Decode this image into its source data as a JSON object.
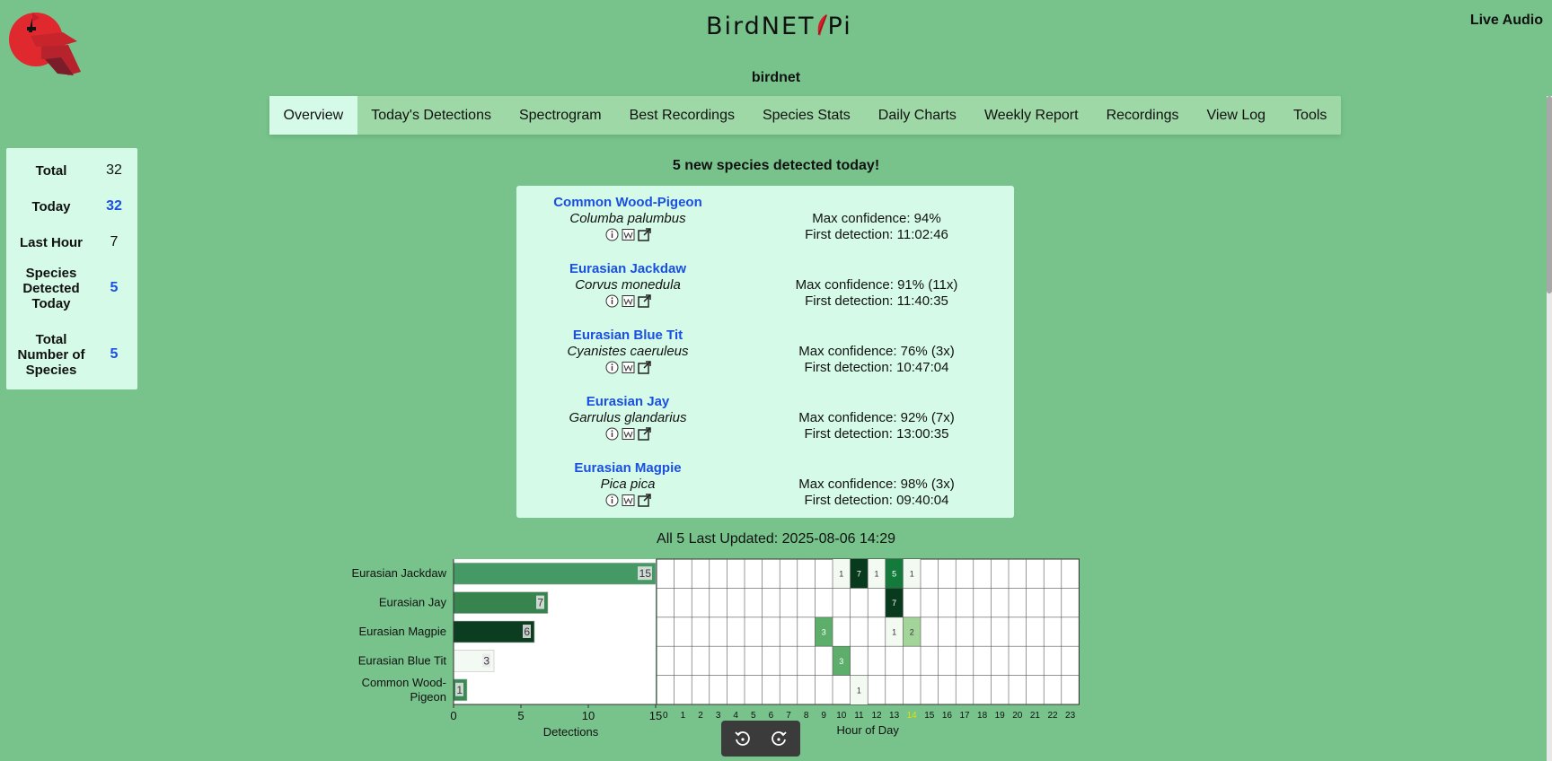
{
  "header": {
    "brand_left": "BirdNET",
    "brand_right": "Pi",
    "live_audio": "Live Audio",
    "site_name": "birdnet"
  },
  "nav": {
    "tabs": [
      {
        "label": "Overview",
        "active": true
      },
      {
        "label": "Today's Detections"
      },
      {
        "label": "Spectrogram"
      },
      {
        "label": "Best Recordings"
      },
      {
        "label": "Species Stats"
      },
      {
        "label": "Daily Charts"
      },
      {
        "label": "Weekly Report"
      },
      {
        "label": "Recordings"
      },
      {
        "label": "View Log"
      },
      {
        "label": "Tools"
      }
    ]
  },
  "stats": [
    {
      "label": "Total",
      "value": "32"
    },
    {
      "label": "Today",
      "value": "32"
    },
    {
      "label": "Last Hour",
      "value": "7"
    },
    {
      "label": "Species Detected Today",
      "value": "5"
    },
    {
      "label": "Total Number of Species",
      "value": "5"
    }
  ],
  "new_species_heading": "5 new species detected today!",
  "species": [
    {
      "common": "Common Wood-Pigeon",
      "scientific": "Columba palumbus",
      "confidence": "Max confidence: 94%",
      "first": "First detection: 11:02:46"
    },
    {
      "common": "Eurasian Jackdaw",
      "scientific": "Corvus monedula",
      "confidence": "Max confidence: 91% (11x)",
      "first": "First detection: 11:40:35"
    },
    {
      "common": "Eurasian Blue Tit",
      "scientific": "Cyanistes caeruleus",
      "confidence": "Max confidence: 76% (3x)",
      "first": "First detection: 10:47:04"
    },
    {
      "common": "Eurasian Jay",
      "scientific": "Garrulus glandarius",
      "confidence": "Max confidence: 92% (7x)",
      "first": "First detection: 13:00:35"
    },
    {
      "common": "Eurasian Magpie",
      "scientific": "Pica pica",
      "confidence": "Max confidence: 98% (3x)",
      "first": "First detection: 09:40:04"
    }
  ],
  "updated_text": "All 5 Last Updated: 2025-08-06 14:29",
  "colors": {
    "background": "#77c38b",
    "card": "#d5fbe8",
    "nav": "#9ed8a6",
    "link": "#1a4fe0",
    "current_hour": "#e0e000"
  },
  "chart_data": [
    {
      "type": "bar",
      "orientation": "horizontal",
      "categories": [
        "Eurasian Jackdaw",
        "Eurasian Jay",
        "Eurasian Magpie",
        "Eurasian Blue Tit",
        "Common Wood-Pigeon"
      ],
      "values": [
        15,
        7,
        6,
        3,
        1
      ],
      "xlabel": "Detections",
      "xlim": [
        0,
        15
      ],
      "xticks": [
        0,
        5,
        10,
        15
      ],
      "bar_colors": [
        "#449964",
        "#37844f",
        "#0c3d21",
        "#f3faf3",
        "#3a8a56"
      ]
    },
    {
      "type": "heatmap",
      "rows": [
        "Eurasian Jackdaw",
        "Eurasian Jay",
        "Eurasian Magpie",
        "Eurasian Blue Tit",
        "Common Wood-Pigeon"
      ],
      "x": [
        0,
        1,
        2,
        3,
        4,
        5,
        6,
        7,
        8,
        9,
        10,
        11,
        12,
        13,
        14,
        15,
        16,
        17,
        18,
        19,
        20,
        21,
        22,
        23
      ],
      "xlabel": "Hour of Day",
      "current_hour": 14,
      "cells": [
        {
          "row": 0,
          "hour": 10,
          "value": 1
        },
        {
          "row": 0,
          "hour": 11,
          "value": 7
        },
        {
          "row": 0,
          "hour": 12,
          "value": 1
        },
        {
          "row": 0,
          "hour": 13,
          "value": 5
        },
        {
          "row": 0,
          "hour": 14,
          "value": 1
        },
        {
          "row": 1,
          "hour": 13,
          "value": 7
        },
        {
          "row": 2,
          "hour": 9,
          "value": 3
        },
        {
          "row": 2,
          "hour": 13,
          "value": 1
        },
        {
          "row": 2,
          "hour": 14,
          "value": 2
        },
        {
          "row": 3,
          "hour": 10,
          "value": 3
        },
        {
          "row": 4,
          "hour": 11,
          "value": 1
        }
      ]
    }
  ]
}
